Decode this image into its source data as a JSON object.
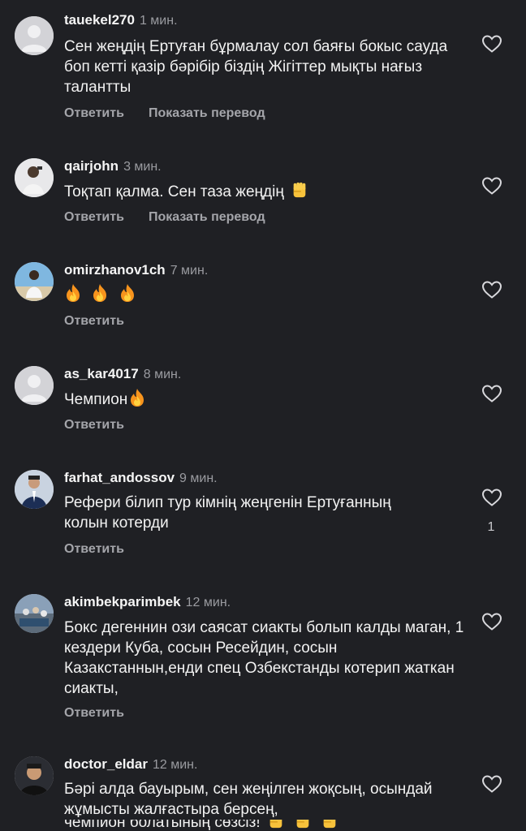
{
  "actions": {
    "reply": "Ответить",
    "translate": "Показать перевод"
  },
  "comments": [
    {
      "user": "tauekel270",
      "time": "1 мин.",
      "text": "Сен жеңдің Ертуған бұрмалау сол баяғы бокыс сауда боп кетті қазір бәрібір біздің Жігіттер мықты нағыз талантты"
    },
    {
      "user": "qairjohn",
      "time": "3 мин.",
      "text": "Тоқтап қалма. Сен таза жеңдің"
    },
    {
      "user": "omirzhanov1ch",
      "time": "7 мин.",
      "text": ""
    },
    {
      "user": "as_kar4017",
      "time": "8 мин.",
      "text": "Чемпион"
    },
    {
      "user": "farhat_andossov",
      "time": "9 мин.",
      "text": "Рефери білип тур кімнің жеңгенін Ертуғанның колын котерди",
      "likes": "1"
    },
    {
      "user": "akimbekparimbek",
      "time": "12 мин.",
      "text": "Бокс дегеннин ози саясат сиакты болып калды маган, 1 кездери Куба, сосын Ресейдин, сосын Казакстаннын,енди спец Озбекстанды котерип жаткан сиакты,"
    },
    {
      "user": "doctor_eldar",
      "time": "12 мин.",
      "text": "Бәрі алда бауырым, сен жеңілген жоқсың, осындай жұмысты жалғастыра берсең,",
      "text_clipped": "чемпион болатының сөзсіз!"
    }
  ],
  "colors": {
    "background": "#1f2024",
    "text": "#f2f2f2",
    "muted": "#9a9ba0",
    "actions": "#a4a5aa"
  },
  "icons": [
    "heart-outline-icon",
    "fire-emoji",
    "raised-fist-emoji"
  ]
}
